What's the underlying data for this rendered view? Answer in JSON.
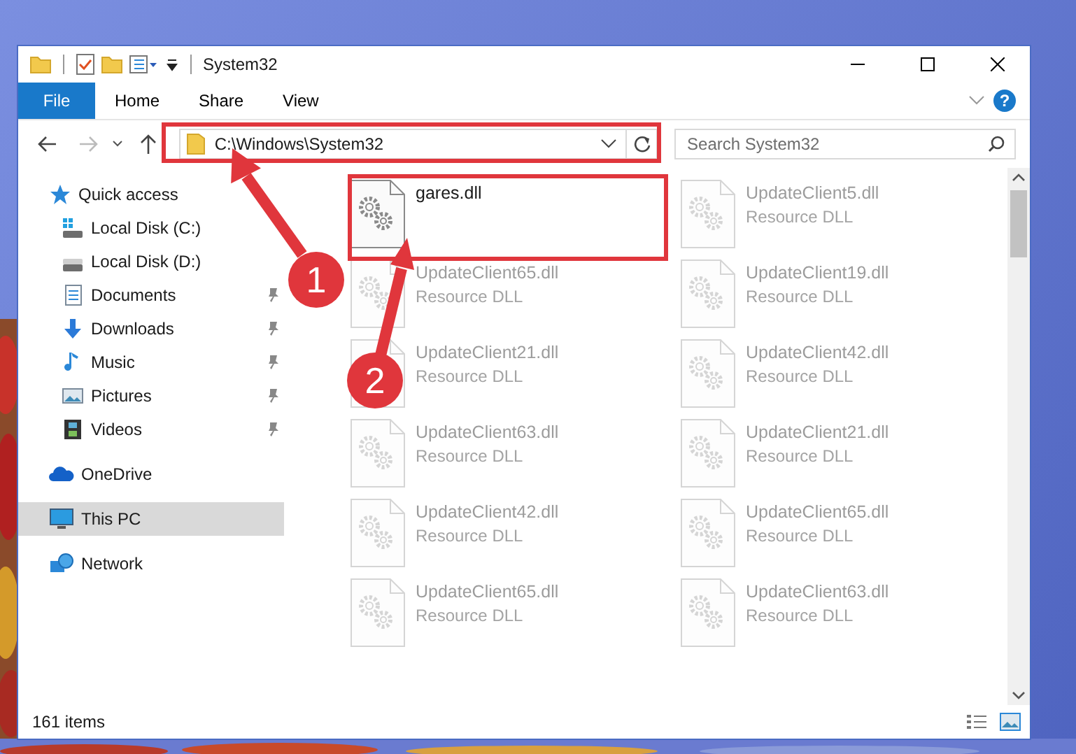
{
  "window": {
    "title": "System32"
  },
  "ribbon": {
    "file_label": "File",
    "tabs": [
      {
        "label": "Home",
        "selected": false
      },
      {
        "label": "Share",
        "selected": false
      },
      {
        "label": "View",
        "selected": false
      }
    ],
    "help_label": "?"
  },
  "address_bar": {
    "path": "C:\\Windows\\System32"
  },
  "search": {
    "placeholder": "Search System32"
  },
  "sidebar": {
    "items": [
      {
        "label": "Quick access",
        "kind": "star",
        "selected": false,
        "children": [
          {
            "label": "Local Disk (C:)",
            "kind": "drive-c",
            "selected": false,
            "pinned": false
          },
          {
            "label": "Local Disk (D:)",
            "kind": "drive",
            "selected": false,
            "pinned": false
          },
          {
            "label": "Documents",
            "kind": "document",
            "selected": false,
            "pinned": true
          },
          {
            "label": "Downloads",
            "kind": "download",
            "selected": false,
            "pinned": true
          },
          {
            "label": "Music",
            "kind": "music",
            "selected": false,
            "pinned": true
          },
          {
            "label": "Pictures",
            "kind": "pictures",
            "selected": false,
            "pinned": true
          },
          {
            "label": "Videos",
            "kind": "videos",
            "selected": false,
            "pinned": true
          }
        ]
      },
      {
        "label": "OneDrive",
        "kind": "cloud",
        "selected": false
      },
      {
        "label": "This PC",
        "kind": "pc",
        "selected": true
      },
      {
        "label": "Network",
        "kind": "network",
        "selected": false
      }
    ]
  },
  "files": [
    {
      "name": "gares.dll",
      "dimmed": false
    },
    {
      "name": "UpdateClient5.dll",
      "type": "Resource DLL",
      "dimmed": true
    },
    {
      "name": "UpdateClient65.dll",
      "type": "Resource DLL",
      "dimmed": true
    },
    {
      "name": "UpdateClient19.dll",
      "type": "Resource DLL",
      "dimmed": true
    },
    {
      "name": "UpdateClient21.dll",
      "type": "Resource DLL",
      "dimmed": true
    },
    {
      "name": "UpdateClient42.dll",
      "type": "Resource DLL",
      "dimmed": true
    },
    {
      "name": "UpdateClient63.dll",
      "type": "Resource DLL",
      "dimmed": true
    },
    {
      "name": "UpdateClient21.dll",
      "type": "Resource DLL",
      "dimmed": true
    },
    {
      "name": "UpdateClient42.dll",
      "type": "Resource DLL",
      "dimmed": true
    },
    {
      "name": "UpdateClient65.dll",
      "type": "Resource DLL",
      "dimmed": true
    },
    {
      "name": "UpdateClient65.dll",
      "type": "Resource DLL",
      "dimmed": true
    },
    {
      "name": "UpdateClient63.dll",
      "type": "Resource DLL",
      "dimmed": true
    }
  ],
  "status_bar": {
    "count": "161 items"
  },
  "annotations": [
    {
      "label": "1"
    },
    {
      "label": "2"
    }
  ]
}
